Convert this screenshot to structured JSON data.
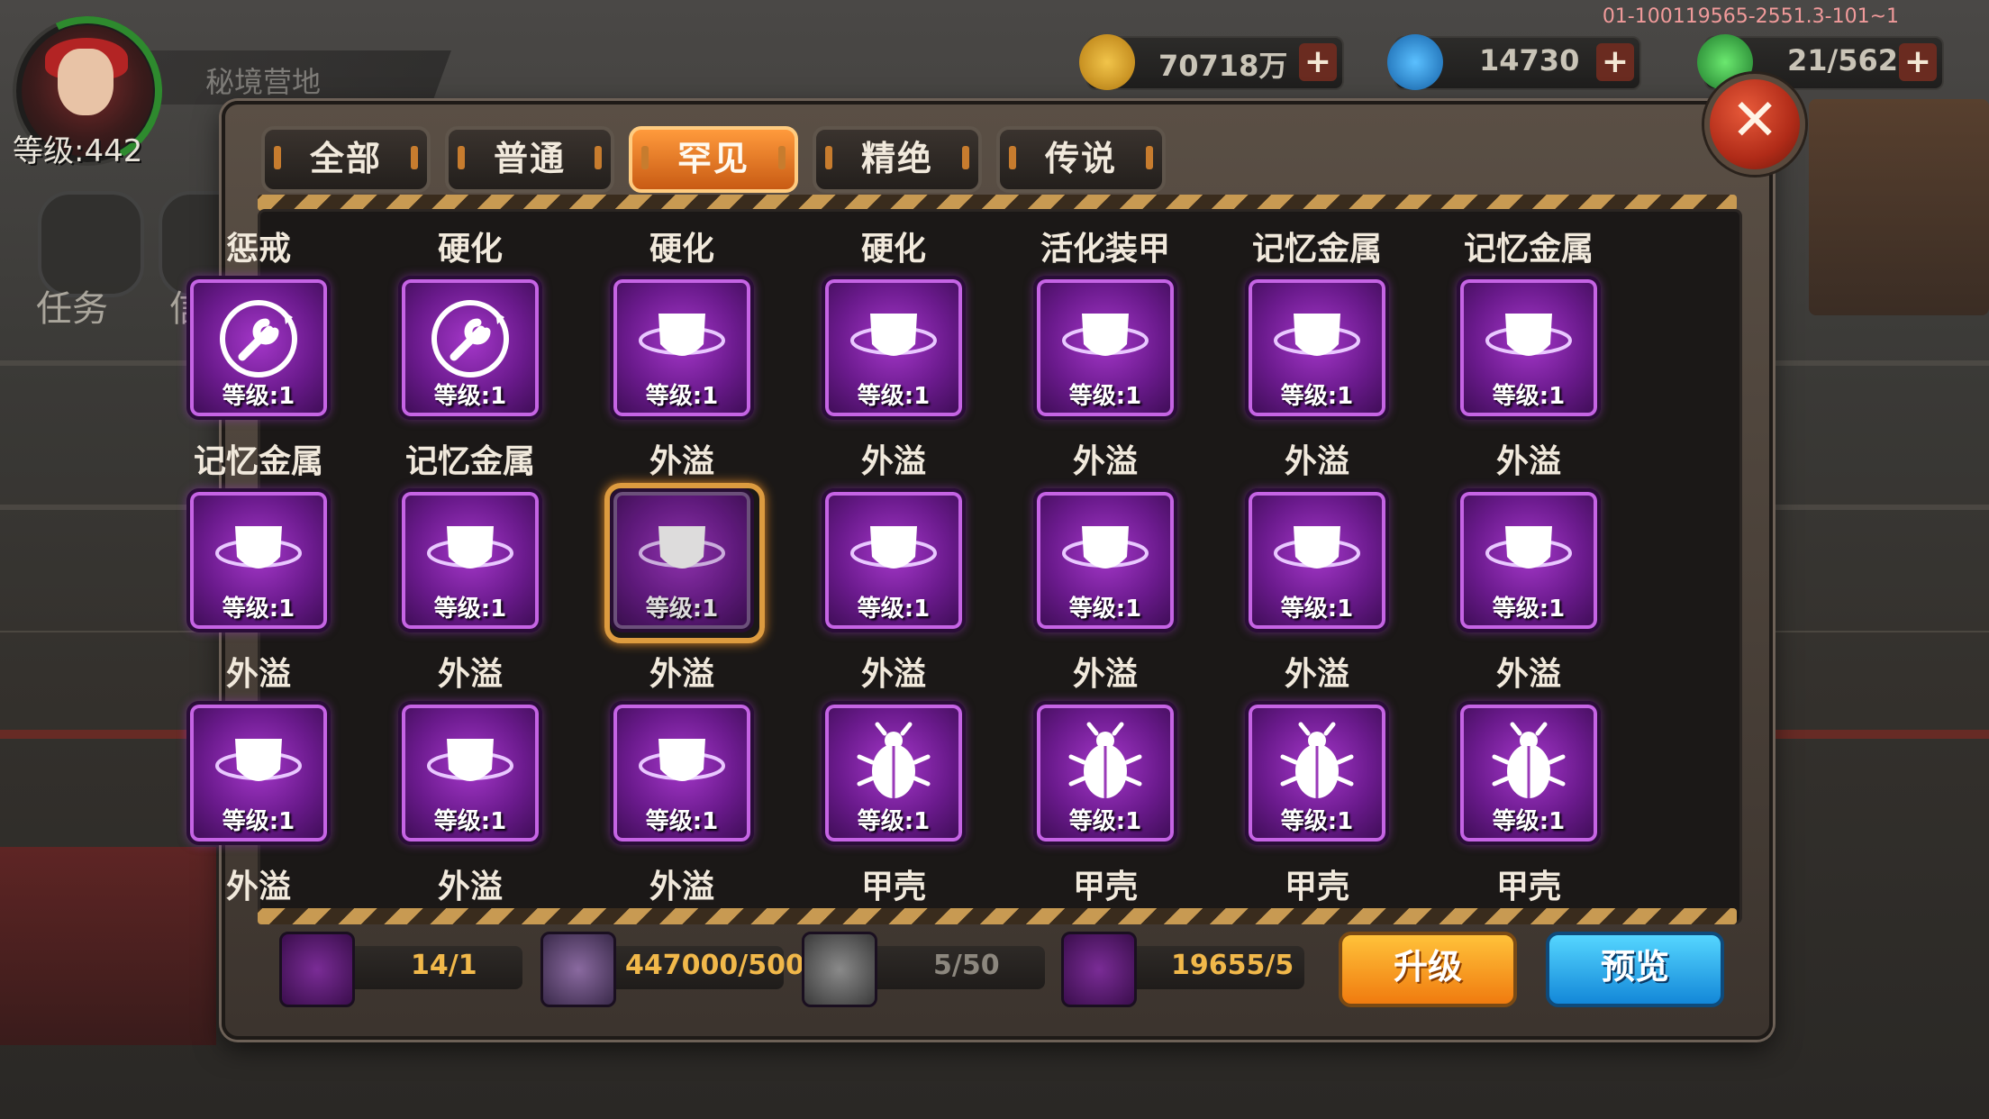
{
  "version": "01-100119565-2551.3-101~1",
  "player": {
    "name": "秘境营地",
    "level": "等级:442"
  },
  "sidebar": {
    "task": "任务",
    "mail": "信"
  },
  "currencies": [
    {
      "value": "70718万",
      "plus": "+",
      "icon": "gold-coin-icon",
      "color": "#d9a12a"
    },
    {
      "value": "14730",
      "plus": "+",
      "icon": "blue-gem-icon",
      "color": "#2a8ad9"
    },
    {
      "value": "21/562",
      "plus": "+",
      "icon": "green-energy-icon",
      "color": "#3ab34a"
    }
  ],
  "close": "✕",
  "tabs": [
    {
      "label": "全部",
      "active": false
    },
    {
      "label": "普通",
      "active": false
    },
    {
      "label": "罕见",
      "active": true
    },
    {
      "label": "精绝",
      "active": false
    },
    {
      "label": "传说",
      "active": false
    }
  ],
  "grid": [
    [
      {
        "title": "惩戒",
        "level": "等级:1",
        "icon": "wrench-icon"
      },
      {
        "title": "硬化",
        "level": "等级:1",
        "icon": "wrench-icon"
      },
      {
        "title": "硬化",
        "level": "等级:1",
        "icon": "shield-icon"
      },
      {
        "title": "硬化",
        "level": "等级:1",
        "icon": "shield-icon"
      },
      {
        "title": "活化装甲",
        "level": "等级:1",
        "icon": "shield-icon"
      },
      {
        "title": "记忆金属",
        "level": "等级:1",
        "icon": "shield-icon"
      },
      {
        "title": "记忆金属",
        "level": "等级:1",
        "icon": "shield-icon"
      }
    ],
    [
      {
        "title": "记忆金属",
        "level": "等级:1",
        "icon": "shield-icon"
      },
      {
        "title": "记忆金属",
        "level": "等级:1",
        "icon": "shield-icon"
      },
      {
        "title": "外溢",
        "level": "等级:1",
        "icon": "shield-icon",
        "selected": true
      },
      {
        "title": "外溢",
        "level": "等级:1",
        "icon": "shield-icon"
      },
      {
        "title": "外溢",
        "level": "等级:1",
        "icon": "shield-icon"
      },
      {
        "title": "外溢",
        "level": "等级:1",
        "icon": "shield-icon"
      },
      {
        "title": "外溢",
        "level": "等级:1",
        "icon": "shield-icon"
      }
    ],
    [
      {
        "title": "外溢",
        "level": "等级:1",
        "icon": "shield-icon"
      },
      {
        "title": "外溢",
        "level": "等级:1",
        "icon": "shield-icon"
      },
      {
        "title": "外溢",
        "level": "等级:1",
        "icon": "shield-icon"
      },
      {
        "title": "外溢",
        "level": "等级:1",
        "icon": "beetle-icon"
      },
      {
        "title": "外溢",
        "level": "等级:1",
        "icon": "beetle-icon"
      },
      {
        "title": "外溢",
        "level": "等级:1",
        "icon": "beetle-icon"
      },
      {
        "title": "外溢",
        "level": "等级:1",
        "icon": "beetle-icon"
      }
    ]
  ],
  "bottom_row_titles": [
    "外溢",
    "外溢",
    "外溢",
    "甲壳",
    "甲壳",
    "甲壳",
    "甲壳"
  ],
  "resources": [
    {
      "value": "14/1",
      "icon": "shield-material-icon",
      "color": "#f1b84a"
    },
    {
      "value": "447000/500",
      "icon": "gold-bar-icon",
      "color": "#f1b84a"
    },
    {
      "value": "5/50",
      "icon": "chip-icon",
      "color": "#8c877e"
    },
    {
      "value": "19655/5",
      "icon": "orb-icon",
      "color": "#f1b84a"
    }
  ],
  "buttons": {
    "upgrade": "升级",
    "preview": "预览"
  }
}
